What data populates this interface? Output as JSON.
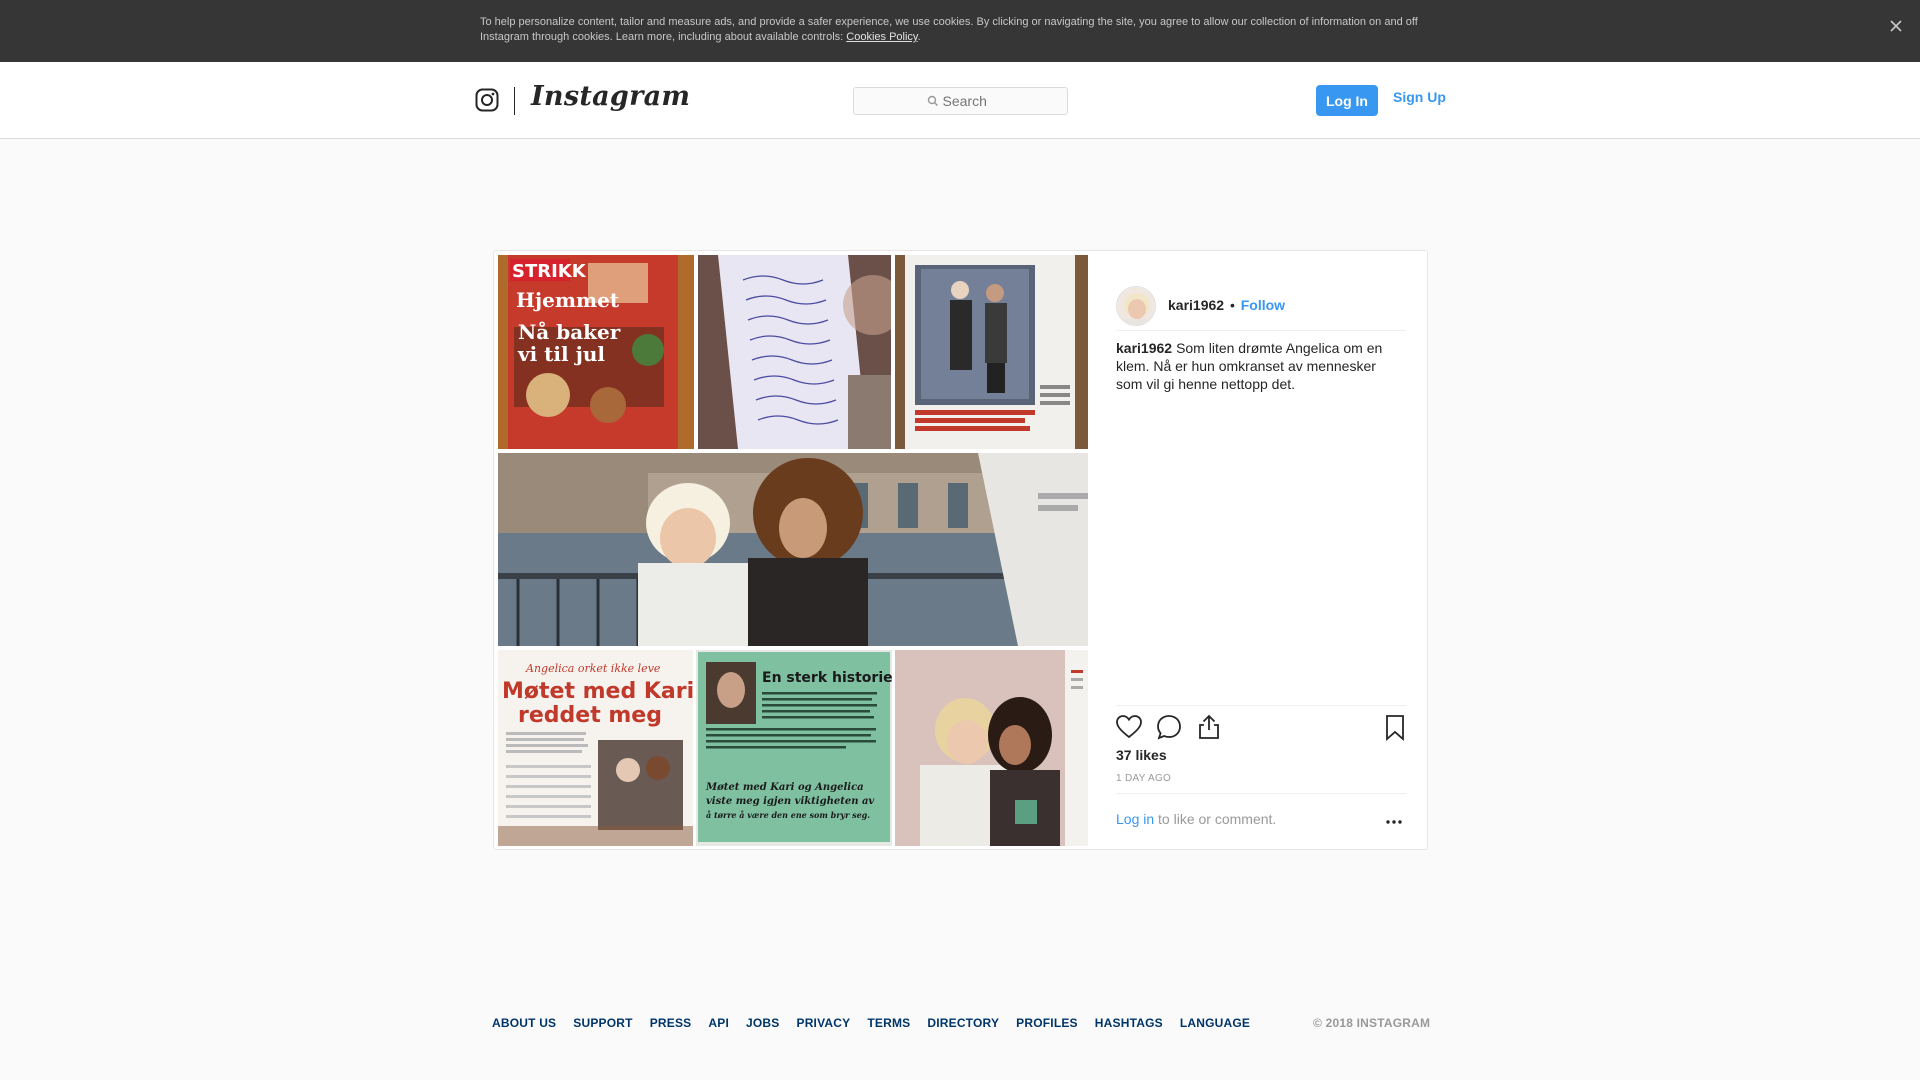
{
  "cookie_banner": {
    "text": "To help personalize content, tailor and measure ads, and provide a safer experience, we use cookies. By clicking or navigating the site, you agree to allow our collection of information on and off Instagram through cookies. Learn more, including about available controls: ",
    "link_label": "Cookies Policy",
    "period": ".",
    "close_icon": "close-icon"
  },
  "header": {
    "brand": "Instagram",
    "glyph_icon": "instagram-camera-icon",
    "search_placeholder": "Search",
    "login_label": "Log In",
    "signup_label": "Sign Up"
  },
  "post": {
    "username": "kari1962",
    "separator": "•",
    "follow_label": "Follow",
    "caption": "Som liten drømte Angelica om en klem. Nå er hun omkranset av mennesker som vil gi henne nettopp det.",
    "likes": "37 likes",
    "time_ago": "1 DAY AGO",
    "login_link": "Log in",
    "login_suffix": " to like or comment.",
    "more_label": "•••",
    "action_icons": [
      "heart-icon",
      "comment-icon",
      "share-icon",
      "bookmark-icon"
    ],
    "collage_text": {
      "mag_title": "STRIKK",
      "mag_name": "Hjemmet",
      "mag_headline_1": "Nå baker",
      "mag_headline_2": "vi til jul",
      "article_title_1": "Møtet med Kari",
      "article_title_2": "reddet meg",
      "article_kicker": "Angelica orket ikke leve",
      "quote_heading": "En sterk historie",
      "quote_text_1": "Møtet med Kari og Angelica",
      "quote_text_2": "viste meg igjen viktigheten av",
      "quote_text_3": "å tørre å være den ene som bryr seg."
    }
  },
  "footer": {
    "links": [
      "ABOUT US",
      "SUPPORT",
      "PRESS",
      "API",
      "JOBS",
      "PRIVACY",
      "TERMS",
      "DIRECTORY",
      "PROFILES",
      "HASHTAGS",
      "LANGUAGE"
    ],
    "copyright": "© 2018 INSTAGRAM"
  },
  "colors": {
    "accent": "#3897f0",
    "banner_bg": "#363636",
    "footer_link": "#003569"
  }
}
